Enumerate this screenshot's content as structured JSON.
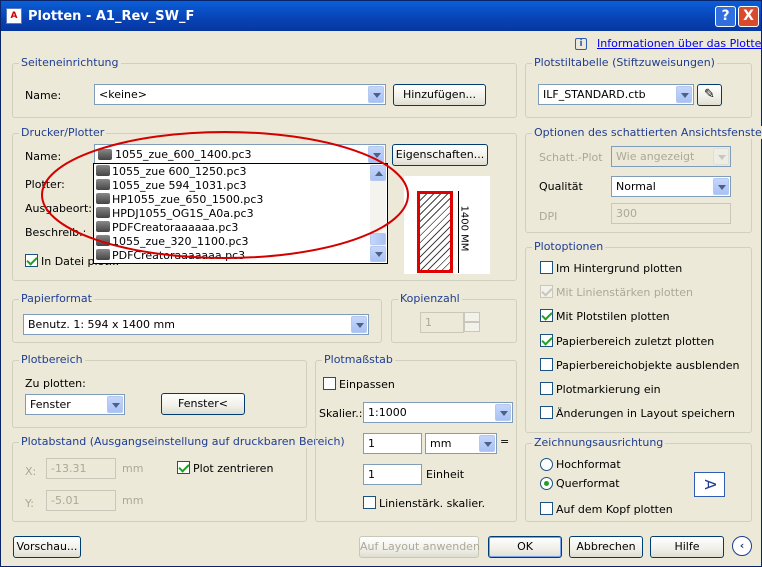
{
  "window": {
    "title": "Plotten - A1_Rev_SW_F",
    "help_symbol": "?",
    "close_symbol": "X",
    "app_icon": "autocad-icon"
  },
  "info": {
    "link": "Informationen über das Plotten",
    "icon_symbol": "i"
  },
  "page_setup": {
    "label": "Seiteneinrichtung",
    "name_label": "Name:",
    "name_value": "<keine>",
    "add_button": "Hinzufügen..."
  },
  "printer": {
    "label": "Drucker/Plotter",
    "name_label": "Name:",
    "name_value": "1055_zue_600_1400.pc3",
    "properties_button": "Eigenschaften...",
    "plotter_label": "Plotter:",
    "location_label": "Ausgabeort:",
    "description_label": "Beschreib.:",
    "print_to_file_label": "In Datei plot...",
    "print_to_file_checked": true,
    "dropdown_items": [
      "1055_zue 600_1250.pc3",
      "1055_zue 594_1031.pc3",
      "HP1055_zue_650_1500.pc3",
      "HPDJ1055_OG1S_A0a.pc3",
      "PDFCreatoraaaaaa.pc3",
      "1055_zue_320_1100.pc3",
      "PDFCreatoraaaaaaa.pc3"
    ],
    "preview_dimension": "1400 MM"
  },
  "plot_style": {
    "label": "Plotstiltabelle (Stiftzuweisungen)",
    "value": "ILF_STANDARD.ctb",
    "edit_icon": "pencil-edit-icon"
  },
  "shaded": {
    "label": "Optionen des schattierten Ansichtsfensters",
    "shade_label": "Schatt.-Plot",
    "shade_value": "Wie angezeigt",
    "quality_label": "Qualität",
    "quality_value": "Normal",
    "dpi_label": "DPI",
    "dpi_value": "300"
  },
  "paper": {
    "label": "Papierformat",
    "value": "Benutz. 1: 594 x 1400 mm"
  },
  "copies": {
    "label": "Kopienzahl",
    "value": "1"
  },
  "plot_area": {
    "label": "Plotbereich",
    "what_label": "Zu plotten:",
    "what_value": "Fenster",
    "window_button": "Fenster<"
  },
  "plot_offset": {
    "label": "Plotabstand (Ausgangseinstellung auf druckbaren Bereich)",
    "x_label": "X:",
    "x_value": "-13.31",
    "y_label": "Y:",
    "y_value": "-5.01",
    "unit": "mm",
    "center_label": "Plot zentrieren",
    "center_checked": true
  },
  "scale": {
    "label": "Plotmaßstab",
    "fit_label": "Einpassen",
    "fit_checked": false,
    "scale_label": "Skalier.:",
    "scale_value": "1:1000",
    "value1": "1",
    "unit_value": "mm",
    "equals": "=",
    "value2": "1",
    "unit2_label": "Einheit",
    "lineweight_label": "Linienstärk. skalier.",
    "lineweight_checked": false
  },
  "plot_options": {
    "label": "Plotoptionen",
    "items": [
      {
        "label": "Im Hintergrund plotten",
        "checked": false,
        "enabled": true
      },
      {
        "label": "Mit Linienstärken plotten",
        "checked": true,
        "enabled": false
      },
      {
        "label": "Mit Plotstilen plotten",
        "checked": true,
        "enabled": true
      },
      {
        "label": "Papierbereich zuletzt plotten",
        "checked": true,
        "enabled": true
      },
      {
        "label": "Papierbereichobjekte ausblenden",
        "checked": false,
        "enabled": true
      },
      {
        "label": "Plotmarkierung ein",
        "checked": false,
        "enabled": true
      },
      {
        "label": "Änderungen in Layout speichern",
        "checked": false,
        "enabled": true
      }
    ]
  },
  "orientation": {
    "label": "Zeichnungsausrichtung",
    "portrait": "Hochformat",
    "landscape": "Querformat",
    "selected": "Querformat",
    "upside_down": "Auf dem Kopf plotten",
    "upside_down_checked": false,
    "icon_letter": "A"
  },
  "footer": {
    "preview": "Vorschau...",
    "apply": "Auf Layout anwenden",
    "ok": "OK",
    "cancel": "Abbrechen",
    "help": "Hilfe",
    "expand_icon": "chevron-left-circle-icon"
  },
  "colors": {
    "accent": "#0a246a",
    "highlight_ellipse": "#d40000",
    "preview_frame": "#e00000"
  }
}
